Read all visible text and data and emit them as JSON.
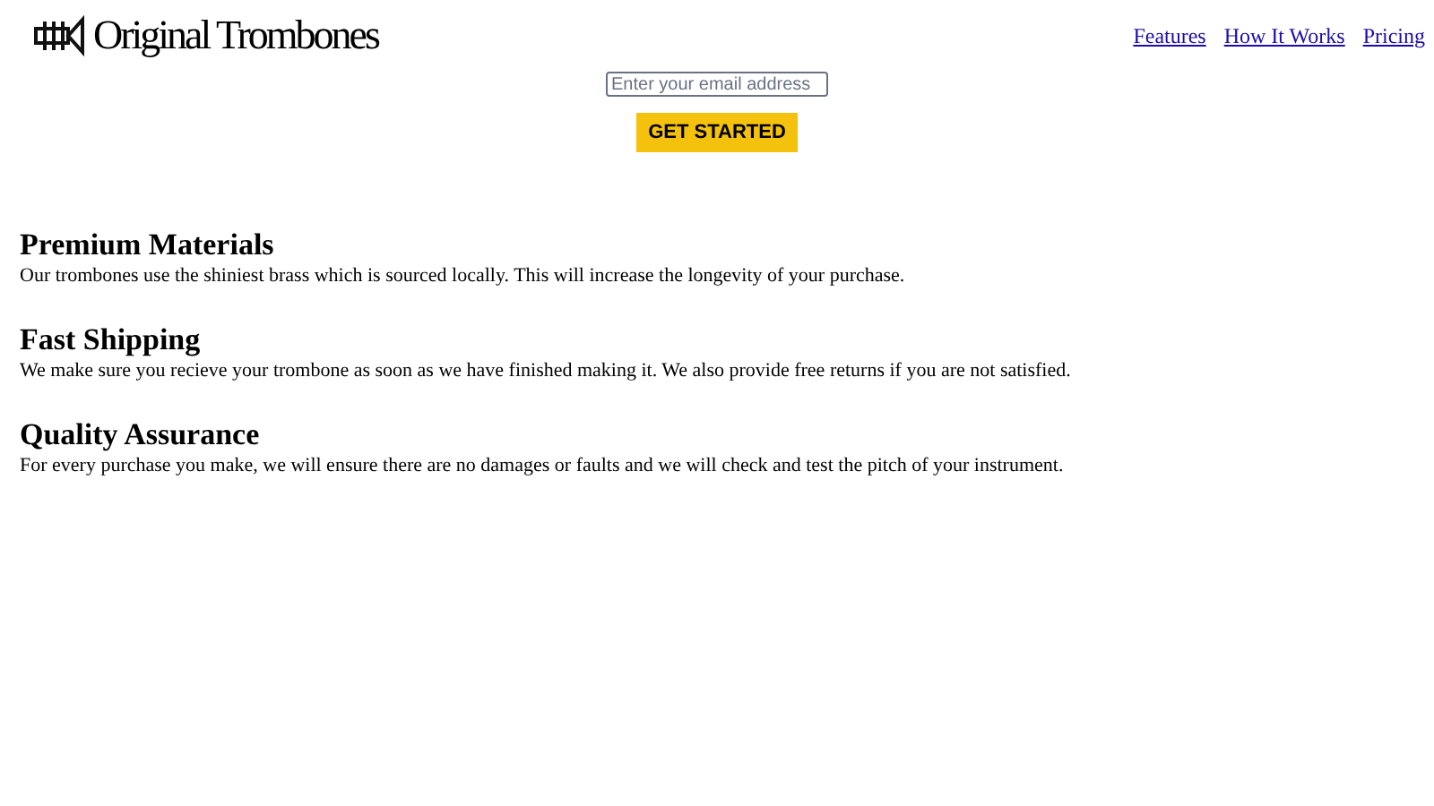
{
  "logo": {
    "text": "Original Trombones"
  },
  "nav": [
    "Features",
    "How It Works",
    "Pricing"
  ],
  "signup": {
    "placeholder": "Enter your email address",
    "button": "GET STARTED"
  },
  "features": [
    {
      "title": "Premium Materials",
      "text": "Our trombones use the shiniest brass which is sourced locally. This will increase the longevity of your purchase."
    },
    {
      "title": "Fast Shipping",
      "text": "We make sure you recieve your trombone as soon as we have finished making it. We also provide free returns if you are not satisfied."
    },
    {
      "title": "Quality Assurance",
      "text": "For every purchase you make, we will ensure there are no damages or faults and we will check and test the pitch of your instrument."
    }
  ]
}
